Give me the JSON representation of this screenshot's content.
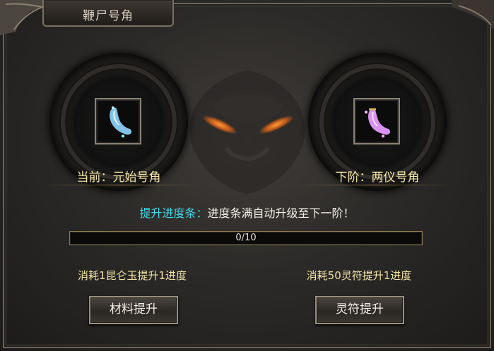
{
  "window": {
    "title": "鞭尸号角"
  },
  "current": {
    "label": "当前：元始号角",
    "icon": "bone-horn-icon"
  },
  "next": {
    "label": "下阶：两仪号角",
    "icon": "bone-horn-icon"
  },
  "progress": {
    "hint_prefix": "提升进度条：",
    "hint_body": "进度条满自动升级至下一阶！",
    "text": "0/10",
    "fraction": 0.0
  },
  "upgrade_material": {
    "cost_text": "消耗1昆仑玉提升1进度",
    "button_label": "材料提升"
  },
  "upgrade_talisman": {
    "cost_text": "消耗50灵符提升1进度",
    "button_label": "灵符提升"
  },
  "colors": {
    "hint_prefix": "#3fd9e8",
    "label_gold": "#f3e6a8",
    "current_horn": "#8fd8ff",
    "next_horn": "#e59bff"
  }
}
